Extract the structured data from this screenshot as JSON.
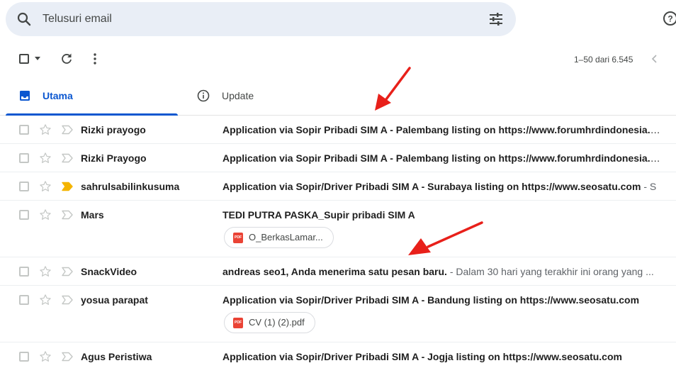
{
  "search": {
    "placeholder": "Telusuri email"
  },
  "toolbar": {
    "pagination": "1–50 dari 6.545"
  },
  "tabs": [
    {
      "label": "Utama",
      "active": true
    },
    {
      "label": "Update",
      "active": false
    }
  ],
  "emails": [
    {
      "sender": "Rizki prayogo",
      "subject": "Application via Sopir Pribadi SIM A - Palembang listing on https://www.forumhrdindonesia.com",
      "snippet": "",
      "important": false
    },
    {
      "sender": "Rizki Prayogo",
      "subject": "Application via Sopir Pribadi SIM A - Palembang listing on https://www.forumhrdindonesia.com",
      "snippet": "",
      "important": false
    },
    {
      "sender": "sahrulsabilinkusuma",
      "subject": "Application via Sopir/Driver Pribadi SIM A - Surabaya listing on https://www.seosatu.com",
      "snippet": " - S",
      "important": true
    },
    {
      "sender": "Mars",
      "subject": "TEDI PUTRA PASKA_Supir pribadi SIM A",
      "snippet": "",
      "important": false,
      "attachment": "O_BerkasLamar..."
    },
    {
      "sender": "SnackVideo",
      "subject": "andreas seo1, Anda menerima satu pesan baru.",
      "snippet": " - Dalam 30 hari yang terakhir ini orang yang ...",
      "important": false
    },
    {
      "sender": "yosua parapat",
      "subject": "Application via Sopir/Driver Pribadi SIM A - Bandung listing on https://www.seosatu.com",
      "snippet": "",
      "important": false,
      "attachment": "CV (1) (2).pdf"
    },
    {
      "sender": "Agus Peristiwa",
      "subject": "Application via Sopir/Driver Pribadi SIM A - Jogja listing on https://www.seosatu.com",
      "snippet": "",
      "important": false
    }
  ],
  "icons": {
    "search": "search-icon",
    "tune": "tune-icon",
    "help": "help-icon",
    "refresh": "refresh-icon",
    "more": "more-vert-icon",
    "inbox": "inbox-icon",
    "info": "info-icon",
    "star": "star-outline-icon",
    "important": "important-marker-icon",
    "pdf": "pdf-icon"
  },
  "colors": {
    "accent": "#0b57d0",
    "search_bg": "#e9eef6",
    "important": "#f4b400",
    "annotation": "#e8201a",
    "pdf": "#ea4335"
  }
}
